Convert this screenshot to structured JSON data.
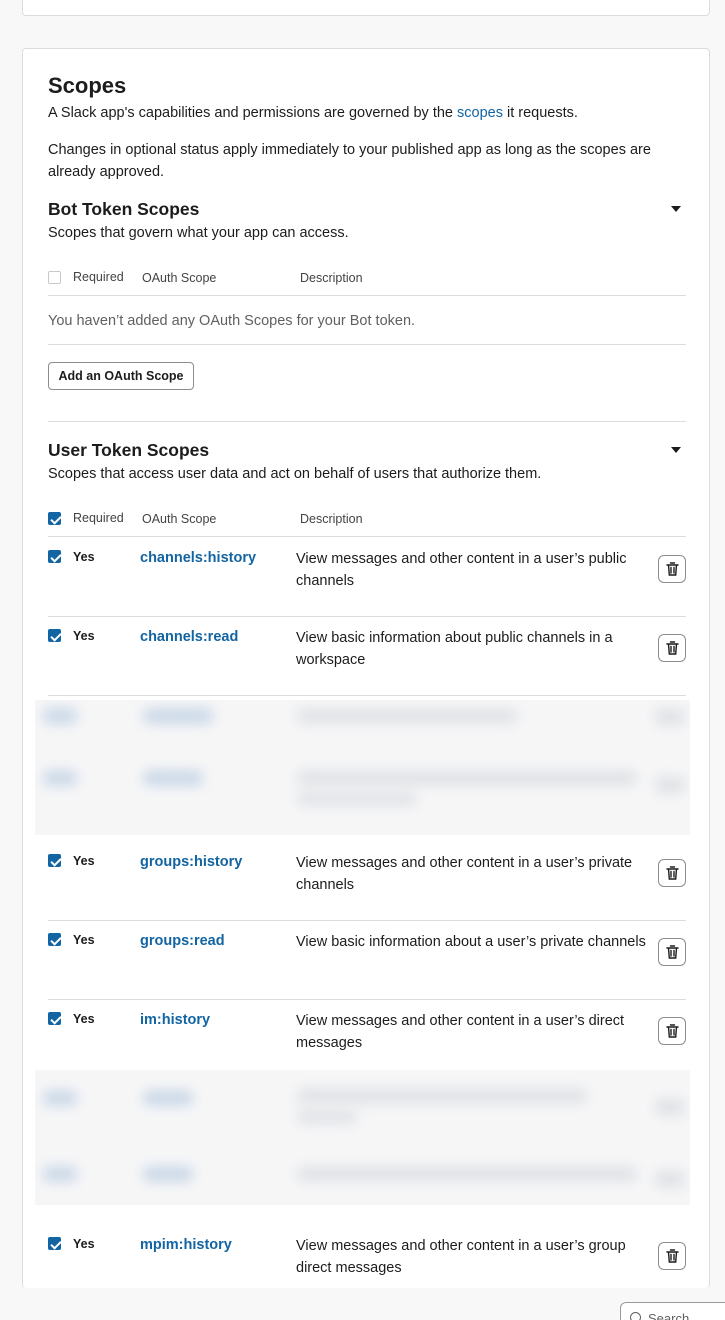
{
  "scopes": {
    "title": "Scopes",
    "intro_prefix": "A Slack app's capabilities and permissions are governed by the ",
    "intro_link": "scopes",
    "intro_suffix": " it requests.",
    "note": "Changes in optional status apply immediately to your published app as long as the scopes are already approved."
  },
  "table_headers": {
    "required": "Required",
    "oauth_scope": "OAuth Scope",
    "description": "Description"
  },
  "bot": {
    "title": "Bot Token Scopes",
    "subtitle": "Scopes that govern what your app can access.",
    "required_checked": false,
    "empty_message": "You haven’t added any OAuth Scopes for your Bot token.",
    "add_button": "Add an OAuth Scope"
  },
  "user": {
    "title": "User Token Scopes",
    "subtitle": "Scopes that access user data and act on behalf of users that authorize them.",
    "required_checked": true,
    "rows": [
      {
        "required": "Yes",
        "checked": true,
        "scope": "channels:history",
        "description": "View messages and other content in a user’s public channels"
      },
      {
        "required": "Yes",
        "checked": true,
        "scope": "channels:read",
        "description": "View basic information about public channels in a workspace"
      },
      {
        "required": "Yes",
        "checked": true,
        "scope": "groups:history",
        "description": "View messages and other content in a user’s private channels"
      },
      {
        "required": "Yes",
        "checked": true,
        "scope": "groups:read",
        "description": "View basic information about a user’s private channels"
      },
      {
        "required": "Yes",
        "checked": true,
        "scope": "im:history",
        "description": "View messages and other content in a user’s direct messages"
      },
      {
        "required": "Yes",
        "checked": true,
        "scope": "mpim:history",
        "description": "View messages and other content in a user’s group direct messages"
      }
    ]
  },
  "search": {
    "label": "Search"
  },
  "icons": {
    "delete": "trash-icon",
    "collapse": "caret-down-icon",
    "search": "search-icon"
  },
  "colors": {
    "link": "#1264a3",
    "checkbox": "#1264a3"
  }
}
